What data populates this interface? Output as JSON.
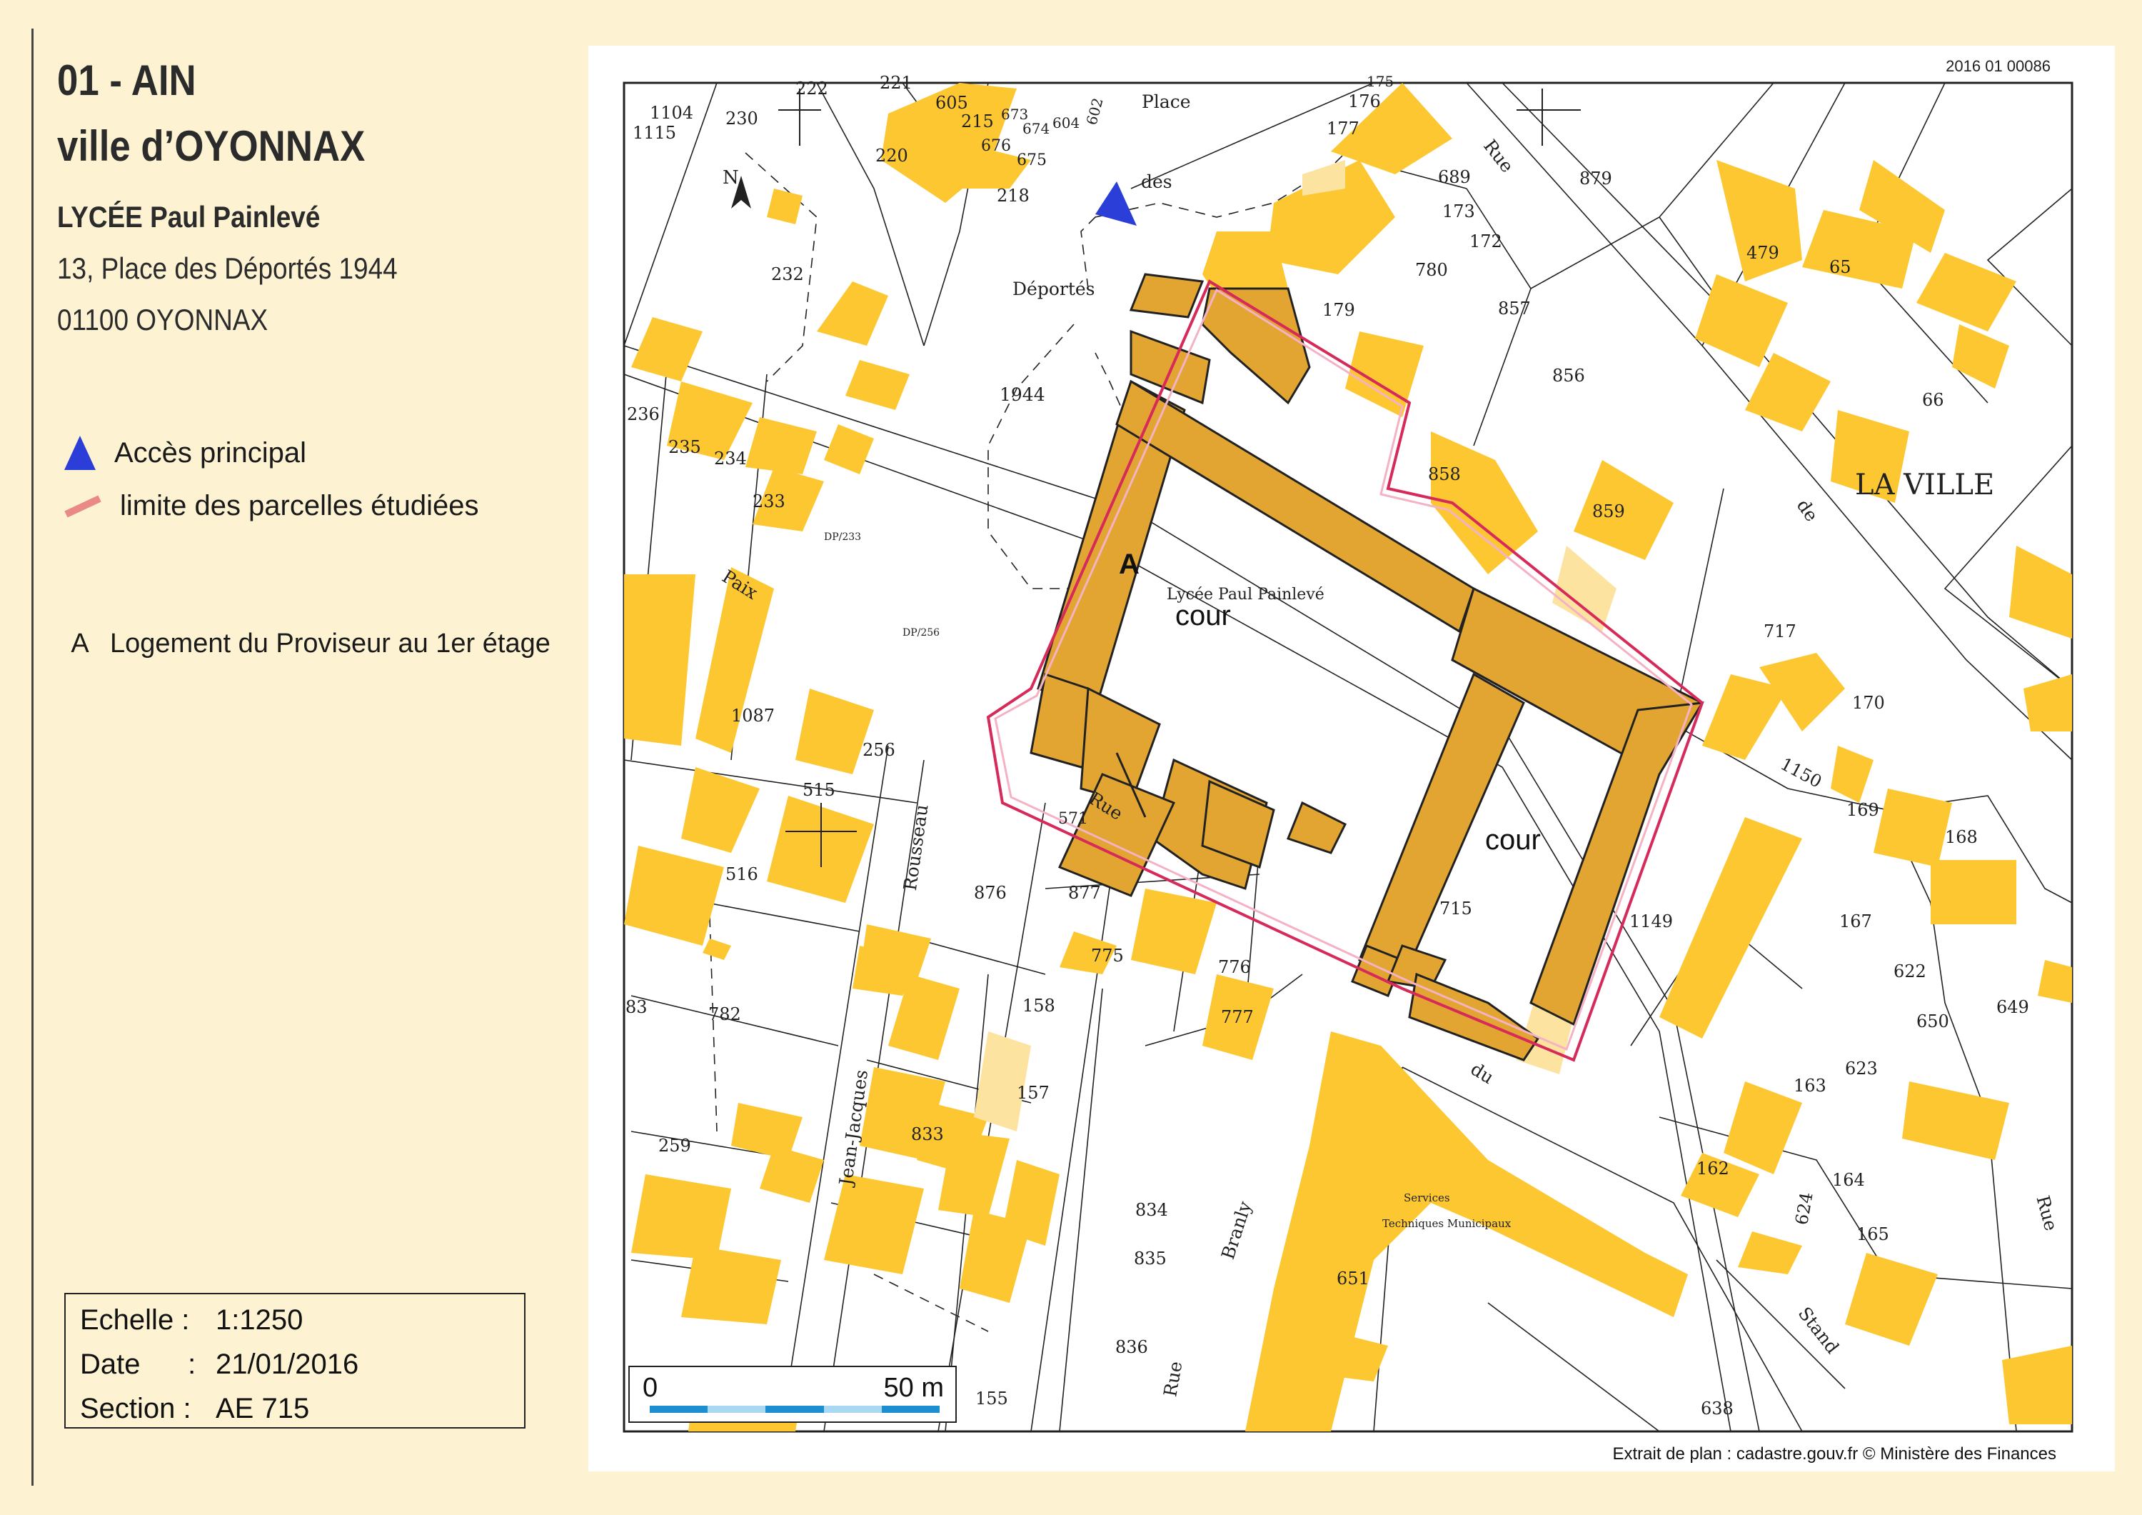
{
  "header": {
    "department": "01 - AIN",
    "city": "ville d’OYONNAX",
    "school": "LYCÉE Paul Painlevé",
    "address_line1": "13, Place des Déportés 1944",
    "address_line2": "01100 OYONNAX"
  },
  "legend": {
    "access_label": "Accès principal",
    "limit_label": "limite des parcelles étudiées",
    "a_letter": "A",
    "a_label": "Logement du Proviseur au 1er étage"
  },
  "info": {
    "scale_key": "Echelle :",
    "scale_value": "1:1250",
    "date_key": "Date      :",
    "date_value": "21/01/2016",
    "section_key": "Section :",
    "section_value": "AE 715"
  },
  "map": {
    "reference": "2016 01 00086",
    "credit": "Extrait de plan : cadastre.gouv.fr © Ministère des Finances",
    "scalebar_start": "0",
    "scalebar_end": "50 m",
    "school_label": "Lycée Paul Painlevé",
    "building_letter": "A",
    "courtyard_1": "cour",
    "courtyard_2": "cour",
    "north": "N",
    "services_1": "Services",
    "services_2": "Techniques Municipaux",
    "streets": {
      "place": "Place",
      "des": "des",
      "deportes": "Déportés",
      "y1944": "1944",
      "rue_top": "Rue",
      "de": "de",
      "la_ville": "LA VILLE",
      "paix": "Paix",
      "rousseau": "Rousseau",
      "jean_jacques": "Jean-Jacques",
      "rue_mid": "Rue",
      "du": "du",
      "stand": "Stand",
      "branly": "Branly",
      "rue_bottom": "Rue",
      "rue_right": "Rue"
    },
    "parcels": [
      "1104",
      "1115",
      "230",
      "222",
      "221",
      "605",
      "215",
      "673",
      "674",
      "604",
      "602",
      "676",
      "675",
      "220",
      "218",
      "232",
      "176",
      "177",
      "175",
      "689",
      "173",
      "172",
      "879",
      "780",
      "179",
      "857",
      "856",
      "479",
      "65",
      "66",
      "1944",
      "236",
      "235",
      "234",
      "233",
      "858",
      "859",
      "DP/233",
      "DP/256",
      "717",
      "170",
      "1087",
      "256",
      "1150",
      "515",
      "169",
      "168",
      "516",
      "571",
      "876",
      "877",
      "715",
      "1149",
      "167",
      "775",
      "776",
      "622",
      "158",
      "777",
      "650",
      "649",
      "782",
      "157",
      "163",
      "623",
      "833",
      "162",
      "164",
      "259",
      "834",
      "624",
      "165",
      "835",
      "651",
      "836",
      "638",
      "155",
      "83"
    ],
    "colors": {
      "building": "#fdc732",
      "school": "#e2a532",
      "limit": "#d62a5a",
      "access": "#2b3fd8",
      "scale_dark": "#1b8fcf",
      "scale_light": "#a9d8f2"
    }
  }
}
